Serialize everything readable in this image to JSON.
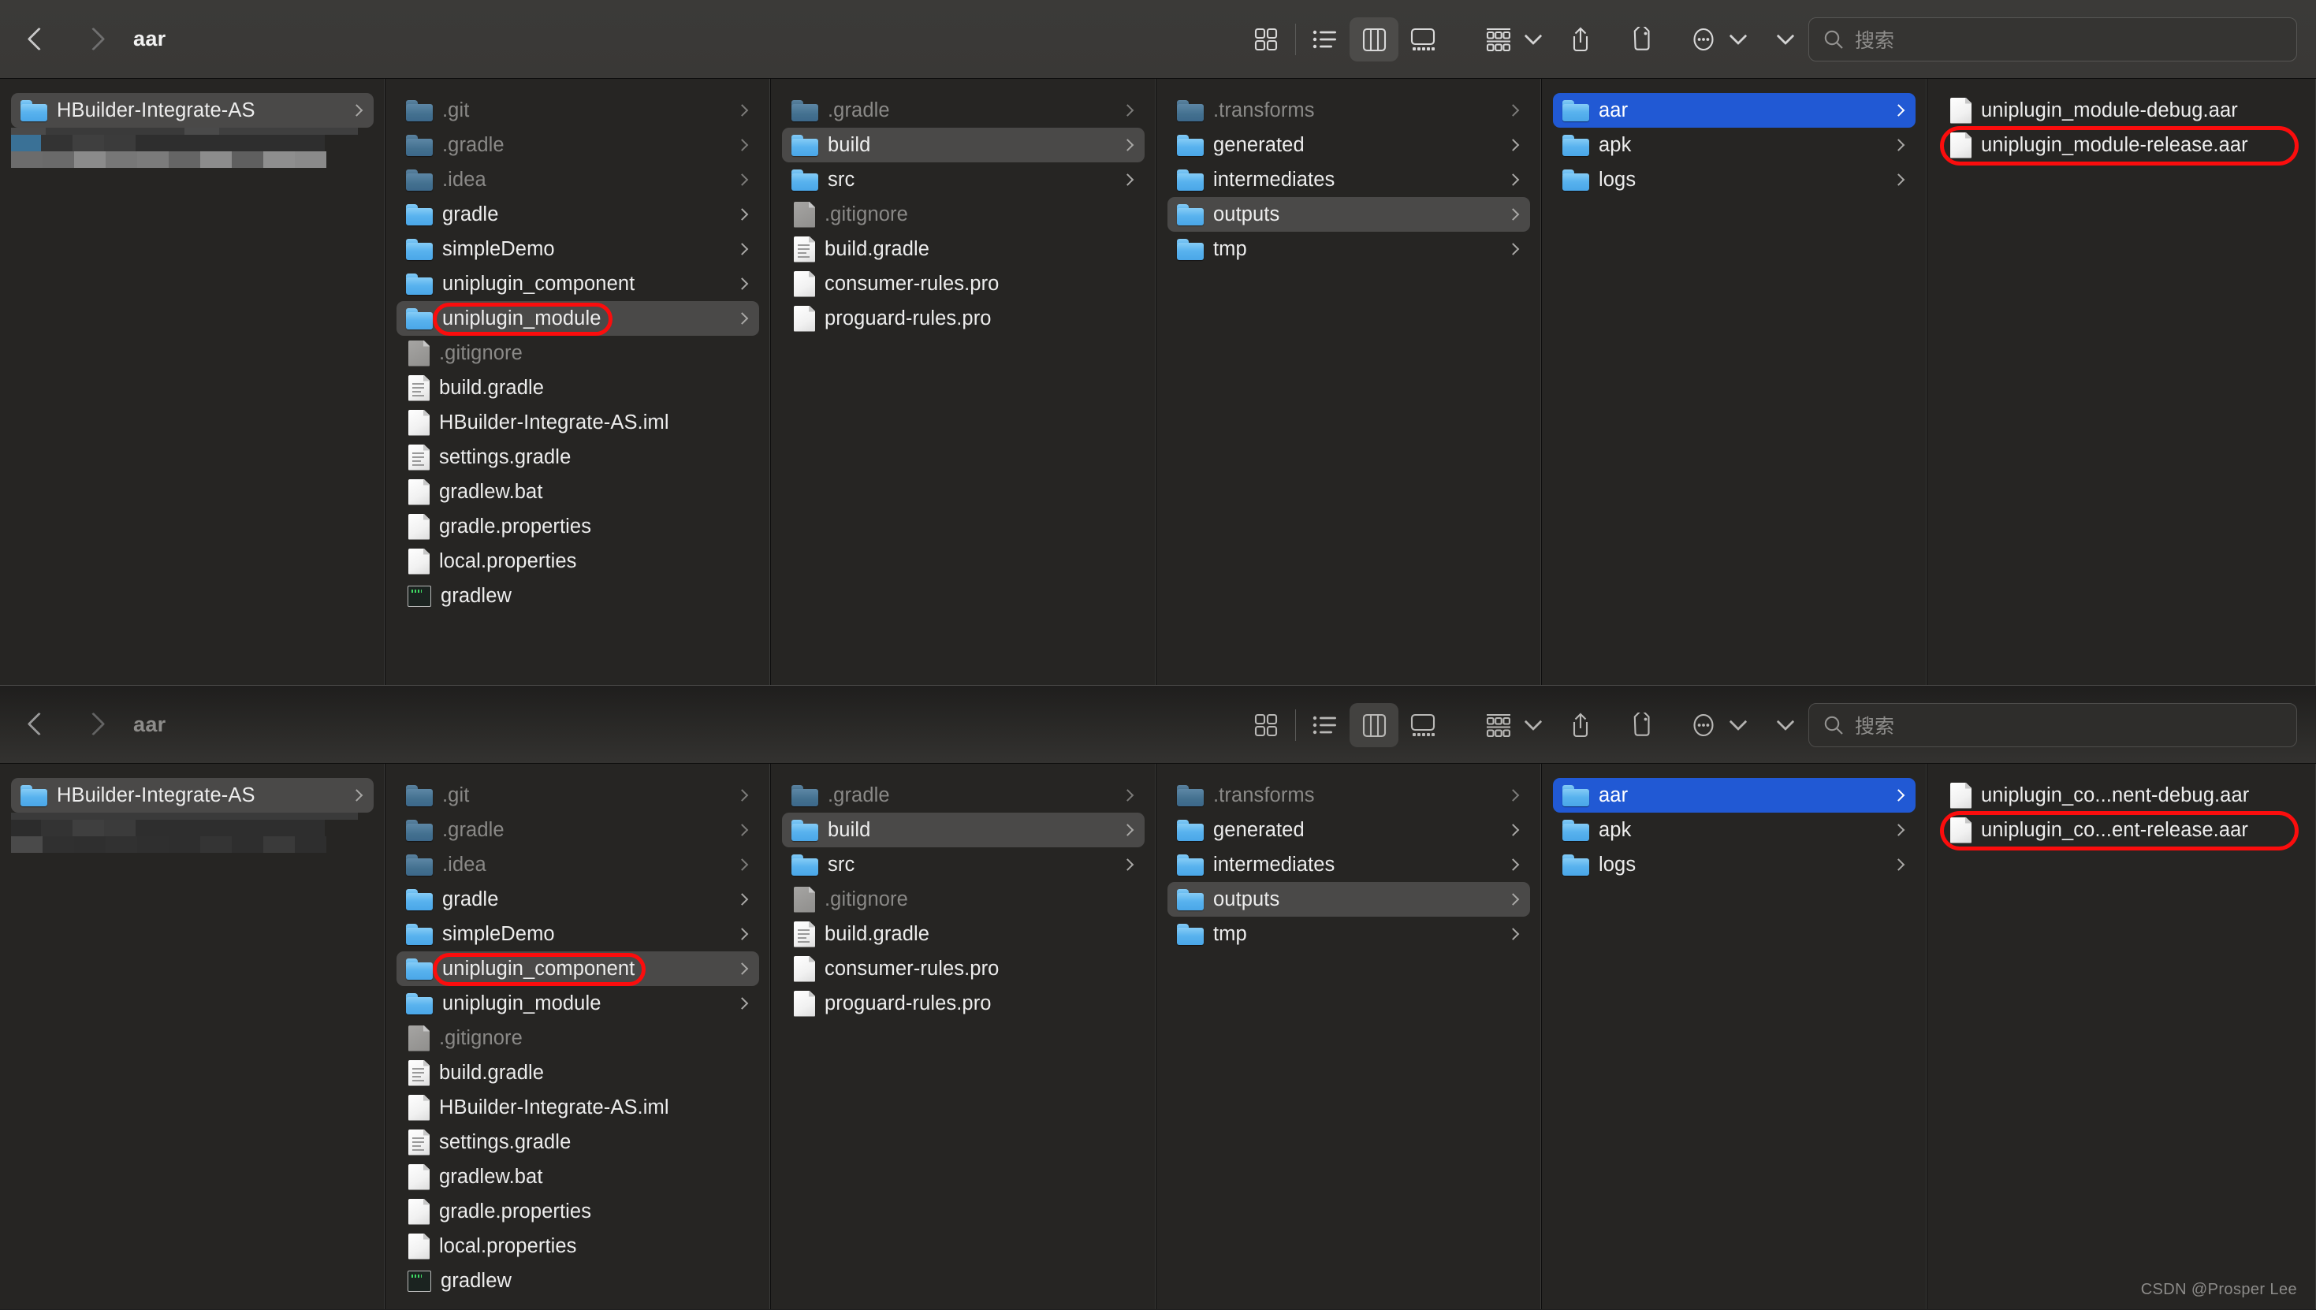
{
  "windows": [
    {
      "title": "aar",
      "search_placeholder": "搜索",
      "toolbar": {
        "back_label": "Back",
        "forward_label": "Forward",
        "icon_view_label": "Icon View",
        "list_view_label": "List View",
        "column_view_label": "Column View",
        "gallery_view_label": "Gallery View",
        "group_label": "Group",
        "share_label": "Share",
        "tag_label": "Tag",
        "more_label": "More",
        "expand_label": "Expand"
      },
      "columns": [
        {
          "name": "sidebar",
          "items": [
            {
              "label": "HBuilder-Integrate-AS",
              "icon": "folder-icon",
              "state": "selected-gray",
              "disclosure": true
            }
          ],
          "redacted": true
        },
        {
          "name": "project-root",
          "items": [
            {
              "label": ".git",
              "icon": "folder-icon",
              "state": "dim",
              "disclosure": true
            },
            {
              "label": ".gradle",
              "icon": "folder-icon",
              "state": "dim",
              "disclosure": true
            },
            {
              "label": ".idea",
              "icon": "folder-icon",
              "state": "dim",
              "disclosure": true
            },
            {
              "label": "gradle",
              "icon": "folder-icon",
              "state": "normal",
              "disclosure": true
            },
            {
              "label": "simpleDemo",
              "icon": "folder-icon",
              "state": "normal",
              "disclosure": true
            },
            {
              "label": "uniplugin_component",
              "icon": "folder-icon",
              "state": "normal",
              "disclosure": true
            },
            {
              "label": "uniplugin_module",
              "icon": "folder-icon",
              "state": "selected-gray",
              "disclosure": true,
              "annotated": true
            },
            {
              "label": ".gitignore",
              "icon": "document-icon",
              "state": "dim",
              "disclosure": false
            },
            {
              "label": "build.gradle",
              "icon": "document-lined-icon",
              "state": "normal",
              "disclosure": false
            },
            {
              "label": "HBuilder-Integrate-AS.iml",
              "icon": "document-icon",
              "state": "normal",
              "disclosure": false
            },
            {
              "label": "settings.gradle",
              "icon": "document-lined-icon",
              "state": "normal",
              "disclosure": false
            },
            {
              "label": "gradlew.bat",
              "icon": "document-icon",
              "state": "normal",
              "disclosure": false
            },
            {
              "label": "gradle.properties",
              "icon": "document-icon",
              "state": "normal",
              "disclosure": false
            },
            {
              "label": "local.properties",
              "icon": "document-icon",
              "state": "normal",
              "disclosure": false
            },
            {
              "label": "gradlew",
              "icon": "executable-icon",
              "state": "normal",
              "disclosure": false
            }
          ]
        },
        {
          "name": "module",
          "items": [
            {
              "label": ".gradle",
              "icon": "folder-icon",
              "state": "dim",
              "disclosure": true
            },
            {
              "label": "build",
              "icon": "folder-icon",
              "state": "selected-gray",
              "disclosure": true
            },
            {
              "label": "src",
              "icon": "folder-icon",
              "state": "normal",
              "disclosure": true
            },
            {
              "label": ".gitignore",
              "icon": "document-icon",
              "state": "dim",
              "disclosure": false
            },
            {
              "label": "build.gradle",
              "icon": "document-lined-icon",
              "state": "normal",
              "disclosure": false
            },
            {
              "label": "consumer-rules.pro",
              "icon": "document-icon",
              "state": "normal",
              "disclosure": false
            },
            {
              "label": "proguard-rules.pro",
              "icon": "document-icon",
              "state": "normal",
              "disclosure": false
            }
          ]
        },
        {
          "name": "build",
          "items": [
            {
              "label": ".transforms",
              "icon": "folder-icon",
              "state": "dim",
              "disclosure": true
            },
            {
              "label": "generated",
              "icon": "folder-icon",
              "state": "normal",
              "disclosure": true
            },
            {
              "label": "intermediates",
              "icon": "folder-icon",
              "state": "normal",
              "disclosure": true
            },
            {
              "label": "outputs",
              "icon": "folder-icon",
              "state": "selected-gray",
              "disclosure": true
            },
            {
              "label": "tmp",
              "icon": "folder-icon",
              "state": "normal",
              "disclosure": true
            }
          ]
        },
        {
          "name": "outputs",
          "items": [
            {
              "label": "aar",
              "icon": "folder-icon",
              "state": "selected-blue",
              "disclosure": true
            },
            {
              "label": "apk",
              "icon": "folder-icon",
              "state": "normal",
              "disclosure": true
            },
            {
              "label": "logs",
              "icon": "folder-icon",
              "state": "normal",
              "disclosure": true
            }
          ]
        },
        {
          "name": "aar",
          "items": [
            {
              "label": "uniplugin_module-debug.aar",
              "icon": "document-icon",
              "state": "normal",
              "disclosure": false
            },
            {
              "label": "uniplugin_module-release.aar",
              "icon": "document-icon",
              "state": "normal",
              "disclosure": false,
              "annotated": true
            }
          ]
        }
      ]
    },
    {
      "title": "aar",
      "search_placeholder": "搜索",
      "toolbar": {
        "back_label": "Back",
        "forward_label": "Forward",
        "icon_view_label": "Icon View",
        "list_view_label": "List View",
        "column_view_label": "Column View",
        "gallery_view_label": "Gallery View",
        "group_label": "Group",
        "share_label": "Share",
        "tag_label": "Tag",
        "more_label": "More",
        "expand_label": "Expand"
      },
      "columns": [
        {
          "name": "sidebar",
          "items": [
            {
              "label": "HBuilder-Integrate-AS",
              "icon": "folder-icon",
              "state": "selected-gray",
              "disclosure": true
            }
          ],
          "redacted": true
        },
        {
          "name": "project-root",
          "items": [
            {
              "label": ".git",
              "icon": "folder-icon",
              "state": "dim",
              "disclosure": true
            },
            {
              "label": ".gradle",
              "icon": "folder-icon",
              "state": "dim",
              "disclosure": true
            },
            {
              "label": ".idea",
              "icon": "folder-icon",
              "state": "dim",
              "disclosure": true
            },
            {
              "label": "gradle",
              "icon": "folder-icon",
              "state": "normal",
              "disclosure": true
            },
            {
              "label": "simpleDemo",
              "icon": "folder-icon",
              "state": "normal",
              "disclosure": true
            },
            {
              "label": "uniplugin_component",
              "icon": "folder-icon",
              "state": "selected-gray",
              "disclosure": true,
              "annotated": true
            },
            {
              "label": "uniplugin_module",
              "icon": "folder-icon",
              "state": "normal",
              "disclosure": true
            },
            {
              "label": ".gitignore",
              "icon": "document-icon",
              "state": "dim",
              "disclosure": false
            },
            {
              "label": "build.gradle",
              "icon": "document-lined-icon",
              "state": "normal",
              "disclosure": false
            },
            {
              "label": "HBuilder-Integrate-AS.iml",
              "icon": "document-icon",
              "state": "normal",
              "disclosure": false
            },
            {
              "label": "settings.gradle",
              "icon": "document-lined-icon",
              "state": "normal",
              "disclosure": false
            },
            {
              "label": "gradlew.bat",
              "icon": "document-icon",
              "state": "normal",
              "disclosure": false
            },
            {
              "label": "gradle.properties",
              "icon": "document-icon",
              "state": "normal",
              "disclosure": false
            },
            {
              "label": "local.properties",
              "icon": "document-icon",
              "state": "normal",
              "disclosure": false
            },
            {
              "label": "gradlew",
              "icon": "executable-icon",
              "state": "normal",
              "disclosure": false
            }
          ]
        },
        {
          "name": "module",
          "items": [
            {
              "label": ".gradle",
              "icon": "folder-icon",
              "state": "dim",
              "disclosure": true
            },
            {
              "label": "build",
              "icon": "folder-icon",
              "state": "selected-gray",
              "disclosure": true
            },
            {
              "label": "src",
              "icon": "folder-icon",
              "state": "normal",
              "disclosure": true
            },
            {
              "label": ".gitignore",
              "icon": "document-icon",
              "state": "dim",
              "disclosure": false
            },
            {
              "label": "build.gradle",
              "icon": "document-lined-icon",
              "state": "normal",
              "disclosure": false
            },
            {
              "label": "consumer-rules.pro",
              "icon": "document-icon",
              "state": "normal",
              "disclosure": false
            },
            {
              "label": "proguard-rules.pro",
              "icon": "document-icon",
              "state": "normal",
              "disclosure": false
            }
          ]
        },
        {
          "name": "build",
          "items": [
            {
              "label": ".transforms",
              "icon": "folder-icon",
              "state": "dim",
              "disclosure": true
            },
            {
              "label": "generated",
              "icon": "folder-icon",
              "state": "normal",
              "disclosure": true
            },
            {
              "label": "intermediates",
              "icon": "folder-icon",
              "state": "normal",
              "disclosure": true
            },
            {
              "label": "outputs",
              "icon": "folder-icon",
              "state": "selected-gray",
              "disclosure": true
            },
            {
              "label": "tmp",
              "icon": "folder-icon",
              "state": "normal",
              "disclosure": true
            }
          ]
        },
        {
          "name": "outputs",
          "items": [
            {
              "label": "aar",
              "icon": "folder-icon",
              "state": "selected-blue",
              "disclosure": true
            },
            {
              "label": "apk",
              "icon": "folder-icon",
              "state": "normal",
              "disclosure": true
            },
            {
              "label": "logs",
              "icon": "folder-icon",
              "state": "normal",
              "disclosure": true
            }
          ]
        },
        {
          "name": "aar",
          "items": [
            {
              "label": "uniplugin_co...nent-debug.aar",
              "icon": "document-icon",
              "state": "normal",
              "disclosure": false
            },
            {
              "label": "uniplugin_co...ent-release.aar",
              "icon": "document-icon",
              "state": "normal",
              "disclosure": false,
              "annotated": true
            }
          ]
        }
      ]
    }
  ],
  "watermark": "CSDN @Prosper Lee",
  "colors": {
    "accent_selected": "#2159d4",
    "selection_gray": "#4a4948",
    "annotation_red": "#fb0d0d",
    "background": "#262523",
    "toolbar": "#3b3a38"
  }
}
